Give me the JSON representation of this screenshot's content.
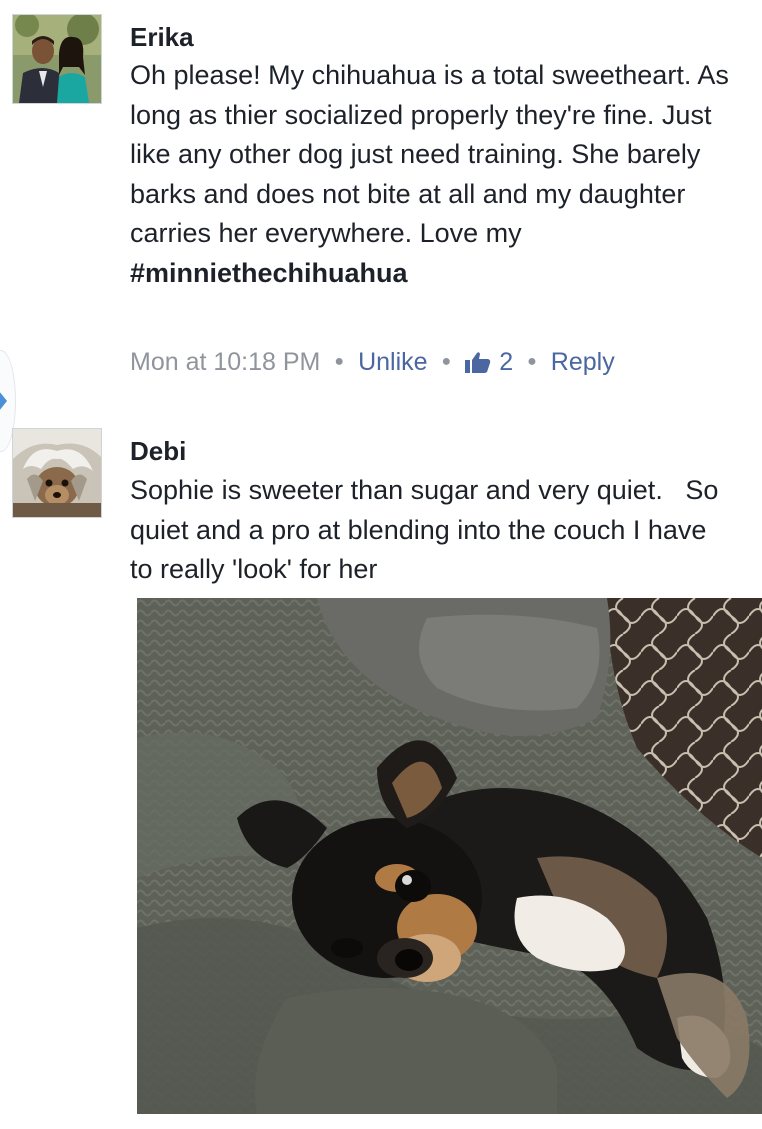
{
  "comments": [
    {
      "author": "Erika",
      "avatar_icon": "couple-profile-photo",
      "text": "Oh please! My chihuahua is a total sweetheart. As long as thier socialized properly they're fine. Just like any other dog just need training. She barely barks and does not bite at all and my daughter carries her everywhere. Love my",
      "hashtag": "#minniethechihuahua",
      "timestamp": "Mon at 10:18 PM",
      "unlike_label": "Unlike",
      "like_count": "2",
      "reply_label": "Reply"
    },
    {
      "author": "Debi",
      "avatar_icon": "dog-profile-photo",
      "text": "Sophie is sweeter than sugar and very quiet.   So quiet and a pro at blending into the couch I have to really 'look' for her",
      "photo_icon": "chihuahua-on-blanket-photo"
    }
  ],
  "colors": {
    "link": "#4b67a1",
    "muted": "#90949c",
    "text": "#1d2129",
    "accent": "#4b8fd6"
  }
}
